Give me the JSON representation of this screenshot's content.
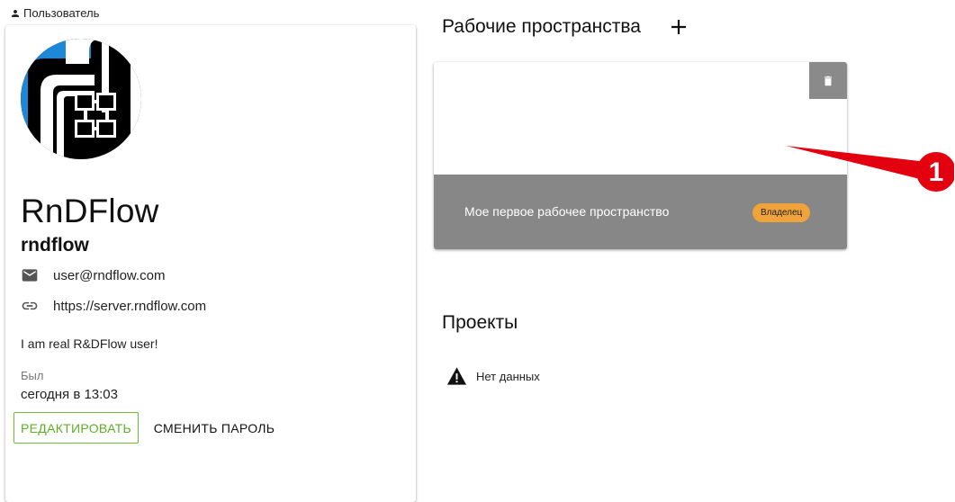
{
  "breadcrumb": {
    "label": "Пользователь",
    "icon": "person-icon"
  },
  "profile": {
    "display_name": "RnDFlow",
    "username": "rndflow",
    "email": "user@rndflow.com",
    "url": "https://server.rndflow.com",
    "bio": "I am real R&DFlow user!",
    "last_seen_label": "Был",
    "last_seen_value": "сегодня в 13:03",
    "edit_label": "РЕДАКТИРОВАТЬ",
    "change_password_label": "СМЕНИТЬ ПАРОЛЬ",
    "colors": {
      "accent": "#5fae26",
      "avatar_blue": "#1e88d8"
    }
  },
  "workspaces": {
    "title": "Рабочие пространства",
    "add_icon": "plus-icon",
    "items": [
      {
        "name": "Мое первое рабочее пространство",
        "role": "Владелец",
        "delete_icon": "trash-icon"
      }
    ]
  },
  "callout": {
    "number": "1",
    "color": "#e3000f"
  },
  "projects": {
    "title": "Проекты",
    "empty_text": "Нет данных",
    "empty_icon": "warning-icon"
  }
}
